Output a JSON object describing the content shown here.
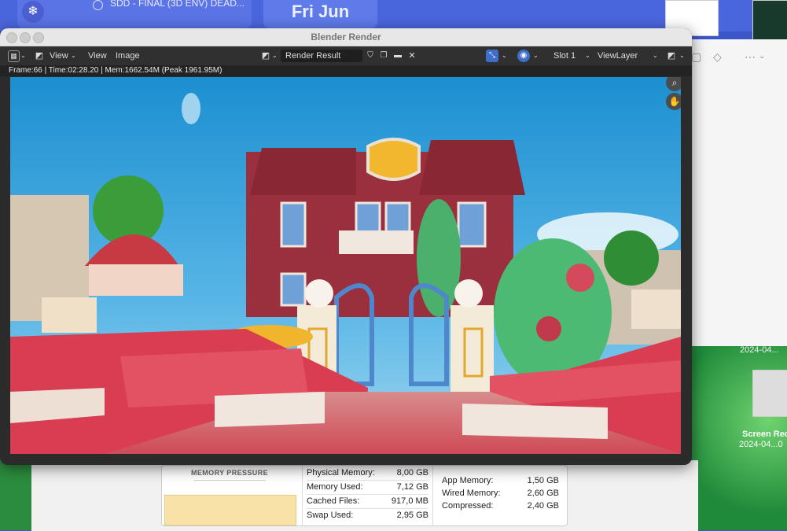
{
  "background": {
    "top_task": "SDD - FINAL (3D ENV) DEAD...",
    "date_chip": "Fri Jun",
    "desktop_date_top": "2024-04...",
    "desktop_file_label": "Screen Rec",
    "desktop_file_date": "2024-04...0"
  },
  "window": {
    "title": "Blender Render"
  },
  "toolbar": {
    "view_menu": "View",
    "view_menu2": "View",
    "image_menu": "Image",
    "render_result": "Render Result",
    "slot": "Slot 1",
    "view_layer": "ViewLayer"
  },
  "info": {
    "stats": "Frame:66 | Time:02:28.20 | Mem:1662.54M (Peak 1961.95M)"
  },
  "memory": {
    "pressure_title": "MEMORY PRESSURE",
    "rows": [
      {
        "label": "Physical Memory:",
        "value": "8,00 GB"
      },
      {
        "label": "Memory Used:",
        "value": "7,12 GB"
      },
      {
        "label": "Cached Files:",
        "value": "917,0 MB"
      },
      {
        "label": "Swap Used:",
        "value": "2,95 GB"
      }
    ],
    "rows2": [
      {
        "label": "App Memory:",
        "value": "1,50 GB"
      },
      {
        "label": "Wired Memory:",
        "value": "2,60 GB"
      },
      {
        "label": "Compressed:",
        "value": "2,40 GB"
      }
    ]
  },
  "colors": {
    "accent": "#3e6ec9",
    "window_bg": "#2b2b2b",
    "pressure": "#f8e2a8"
  }
}
